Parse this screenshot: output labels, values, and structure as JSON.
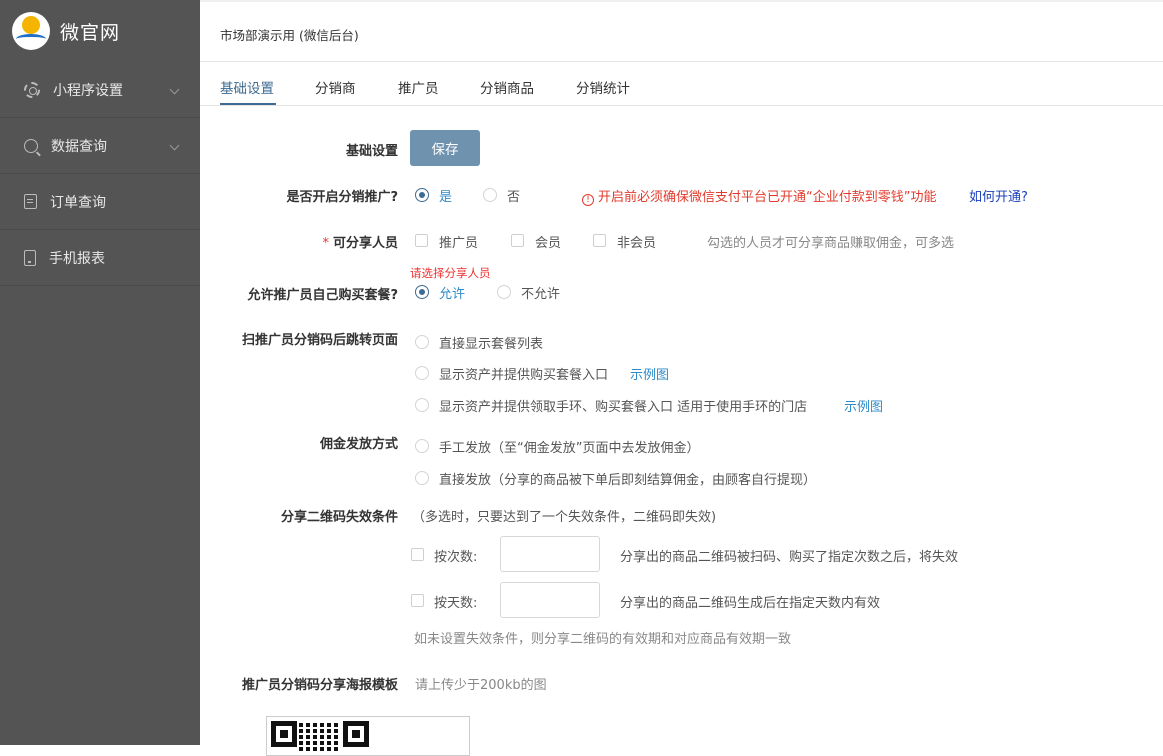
{
  "sidebar": {
    "logo_text": "微官网",
    "items": [
      {
        "label": "小程序设置",
        "icon": "gear-icon",
        "has_submenu": true
      },
      {
        "label": "数据查询",
        "icon": "search-icon",
        "has_submenu": true
      },
      {
        "label": "订单查询",
        "icon": "document-icon",
        "has_submenu": false
      },
      {
        "label": "手机报表",
        "icon": "phone-icon",
        "has_submenu": false
      }
    ]
  },
  "header": {
    "title": "市场部演示用 (微信后台)"
  },
  "tabs": [
    {
      "label": "基础设置",
      "active": true
    },
    {
      "label": "分销商",
      "active": false
    },
    {
      "label": "推广员",
      "active": false
    },
    {
      "label": "分销商品",
      "active": false
    },
    {
      "label": "分销统计",
      "active": false
    }
  ],
  "form": {
    "basic_settings": {
      "label": "基础设置",
      "save_label": "保存"
    },
    "enable_distribution": {
      "label": "是否开启分销推广?",
      "options": [
        {
          "label": "是",
          "selected": true
        },
        {
          "label": "否",
          "selected": false
        }
      ],
      "warning": "开启前必须确保微信支付平台已开通“企业付款到零钱”功能",
      "help_link": "如何开通?"
    },
    "share_people": {
      "label": "可分享人员",
      "required_mark": "*",
      "options": [
        {
          "label": "推广员",
          "checked": false
        },
        {
          "label": "会员",
          "checked": false
        },
        {
          "label": "非会员",
          "checked": false
        }
      ],
      "hint": "勾选的人员才可分享商品赚取佣金，可多选",
      "error": "请选择分享人员"
    },
    "self_purchase": {
      "label": "允许推广员自己购买套餐?",
      "options": [
        {
          "label": "允许",
          "selected": true
        },
        {
          "label": "不允许",
          "selected": false
        }
      ]
    },
    "redirect_page": {
      "label": "扫推广员分销码后跳转页面",
      "options": [
        {
          "label": "直接显示套餐列表",
          "link": ""
        },
        {
          "label": "显示资产并提供购买套餐入口",
          "link": "示例图"
        },
        {
          "label": "显示资产并提供领取手环、购买套餐入口 适用于使用手环的门店",
          "link": "示例图"
        }
      ]
    },
    "commission": {
      "label": "佣金发放方式",
      "options": [
        {
          "label": "手工发放（至“佣金发放”页面中去发放佣金）"
        },
        {
          "label": "直接发放（分享的商品被下单后即刻结算佣金，由顾客自行提现）"
        }
      ]
    },
    "qr_expiry": {
      "label": "分享二维码失效条件",
      "note": "（多选时，只要达到了一个失效条件，二维码即失效)",
      "by_count": {
        "label": "按次数:",
        "value": "",
        "desc": "分享出的商品二维码被扫码、购买了指定次数之后，将失效"
      },
      "by_days": {
        "label": "按天数:",
        "value": "",
        "desc": "分享出的商品二维码生成后在指定天数内有效"
      },
      "footnote": "如未设置失效条件，则分享二维码的有效期和对应商品有效期一致"
    },
    "poster": {
      "label": "推广员分销码分享海报模板",
      "hint": "请上传少于200kb的图"
    }
  }
}
